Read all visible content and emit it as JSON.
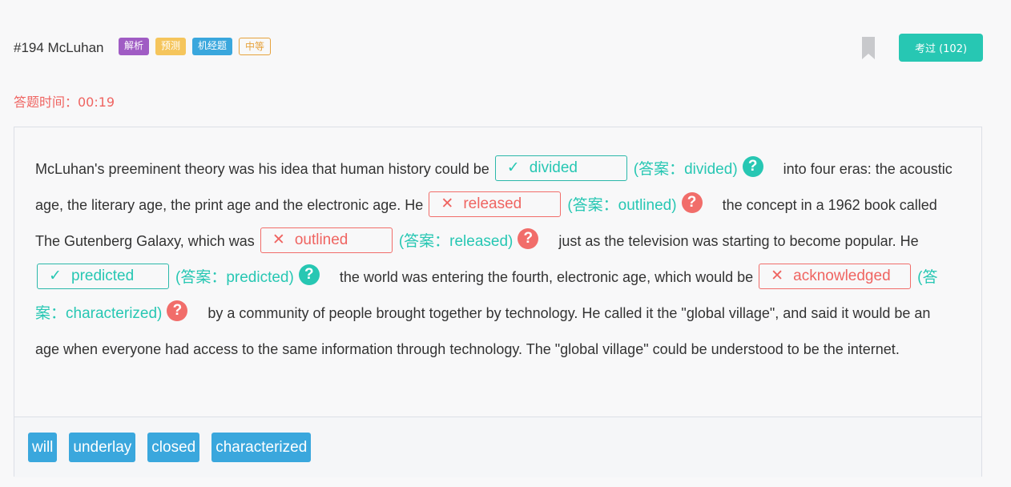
{
  "header": {
    "title": "#194 McLuhan",
    "badges": [
      "解析",
      "预测",
      "机经题",
      "中等"
    ],
    "exam_button": "考过 (102)"
  },
  "timer": "答题时间：00:19",
  "passage": {
    "s0": "McLuhan's preeminent theory was his idea that human history could be",
    "s1": "into four eras: the acoustic age, the literary age, the print age and the electronic age. He",
    "s2": "the concept in a 1962 book called The Gutenberg Galaxy, which was",
    "s3": "just as the television was starting to become popular. He",
    "s4": "the world was entering the fourth, electronic age, which would be",
    "s5": "by a community of people brought together by technology. He called it the \"global village\", and said it would be an age when everyone had access to the same information through technology. The \"global village\" could be understood to be the internet.",
    "blanks": [
      {
        "value": "divided",
        "answer": "(答案：divided)",
        "status": "correct"
      },
      {
        "value": "released",
        "answer": "(答案：outlined)",
        "status": "wrong"
      },
      {
        "value": "outlined",
        "answer": "(答案：released)",
        "status": "wrong"
      },
      {
        "value": "predicted",
        "answer": "(答案：predicted)",
        "status": "correct"
      },
      {
        "value": "acknowledged",
        "answer": "(答案：characterized)",
        "status": "wrong"
      }
    ]
  },
  "word_bank": [
    "will",
    "underlay",
    "closed",
    "characterized"
  ],
  "icons": {
    "correct": "check-icon",
    "wrong": "cross-icon",
    "help": "question-circle-icon",
    "bookmark": "bookmark-icon"
  },
  "colors": {
    "accent": "#27c7b3",
    "error": "#ef6461",
    "chip": "#3aa7dd"
  }
}
